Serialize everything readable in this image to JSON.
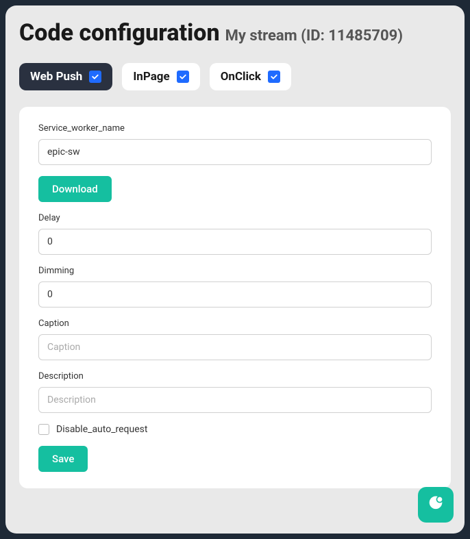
{
  "header": {
    "title": "Code configuration",
    "subtitle": "My stream (ID: 11485709)"
  },
  "tabs": [
    {
      "label": "Web Push",
      "checked": true,
      "active": true
    },
    {
      "label": "InPage",
      "checked": true,
      "active": false
    },
    {
      "label": "OnClick",
      "checked": true,
      "active": false
    }
  ],
  "form": {
    "service_worker_label": "Service_worker_name",
    "service_worker_value": "epic-sw",
    "download_label": "Download",
    "delay_label": "Delay",
    "delay_value": "0",
    "dimming_label": "Dimming",
    "dimming_value": "0",
    "caption_label": "Caption",
    "caption_placeholder": "Caption",
    "caption_value": "",
    "description_label": "Description",
    "description_placeholder": "Description",
    "description_value": "",
    "disable_auto_request_label": "Disable_auto_request",
    "disable_auto_request_checked": false,
    "save_label": "Save"
  }
}
